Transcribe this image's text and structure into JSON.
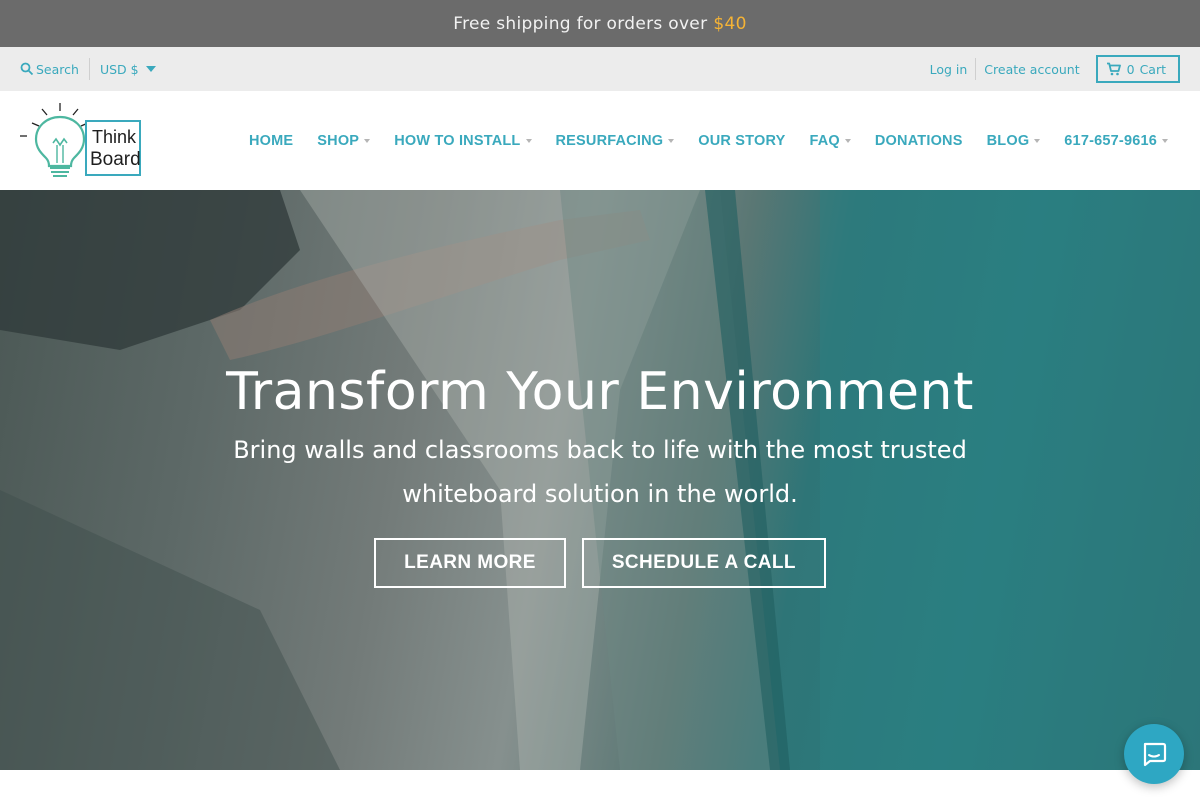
{
  "announcement": {
    "text": "Free shipping for orders over",
    "amount": "$40"
  },
  "utility": {
    "search_label": "Search",
    "currency": "USD $",
    "login": "Log in",
    "create_account": "Create account",
    "cart_count": "0",
    "cart_label": "Cart"
  },
  "logo": {
    "line1": "Think",
    "line2": "Board"
  },
  "nav": {
    "items": [
      {
        "label": "Home"
      },
      {
        "label": "Shop"
      },
      {
        "label": "How to install"
      },
      {
        "label": "Resurfacing"
      },
      {
        "label": "Our Story"
      },
      {
        "label": "FAQ"
      },
      {
        "label": "Donations"
      },
      {
        "label": "Blog"
      },
      {
        "label": "617-657-9616"
      }
    ]
  },
  "hero": {
    "title": "Transform Your Environment",
    "subtitle": "Bring walls and classrooms back to life with the most trusted whiteboard solution in the world.",
    "buttons": [
      "Learn More",
      "Schedule a call"
    ]
  },
  "colors": {
    "accent": "#3aa9bd",
    "announcement_bg": "#6b6b6b",
    "announcement_amount": "#f5b335",
    "utility_bg": "#ececec",
    "chat_bg": "#2ea7c3"
  },
  "icons": {
    "search": "search-icon",
    "cart": "cart-icon",
    "chat": "chat-icon",
    "logo": "lightbulb-logo"
  }
}
